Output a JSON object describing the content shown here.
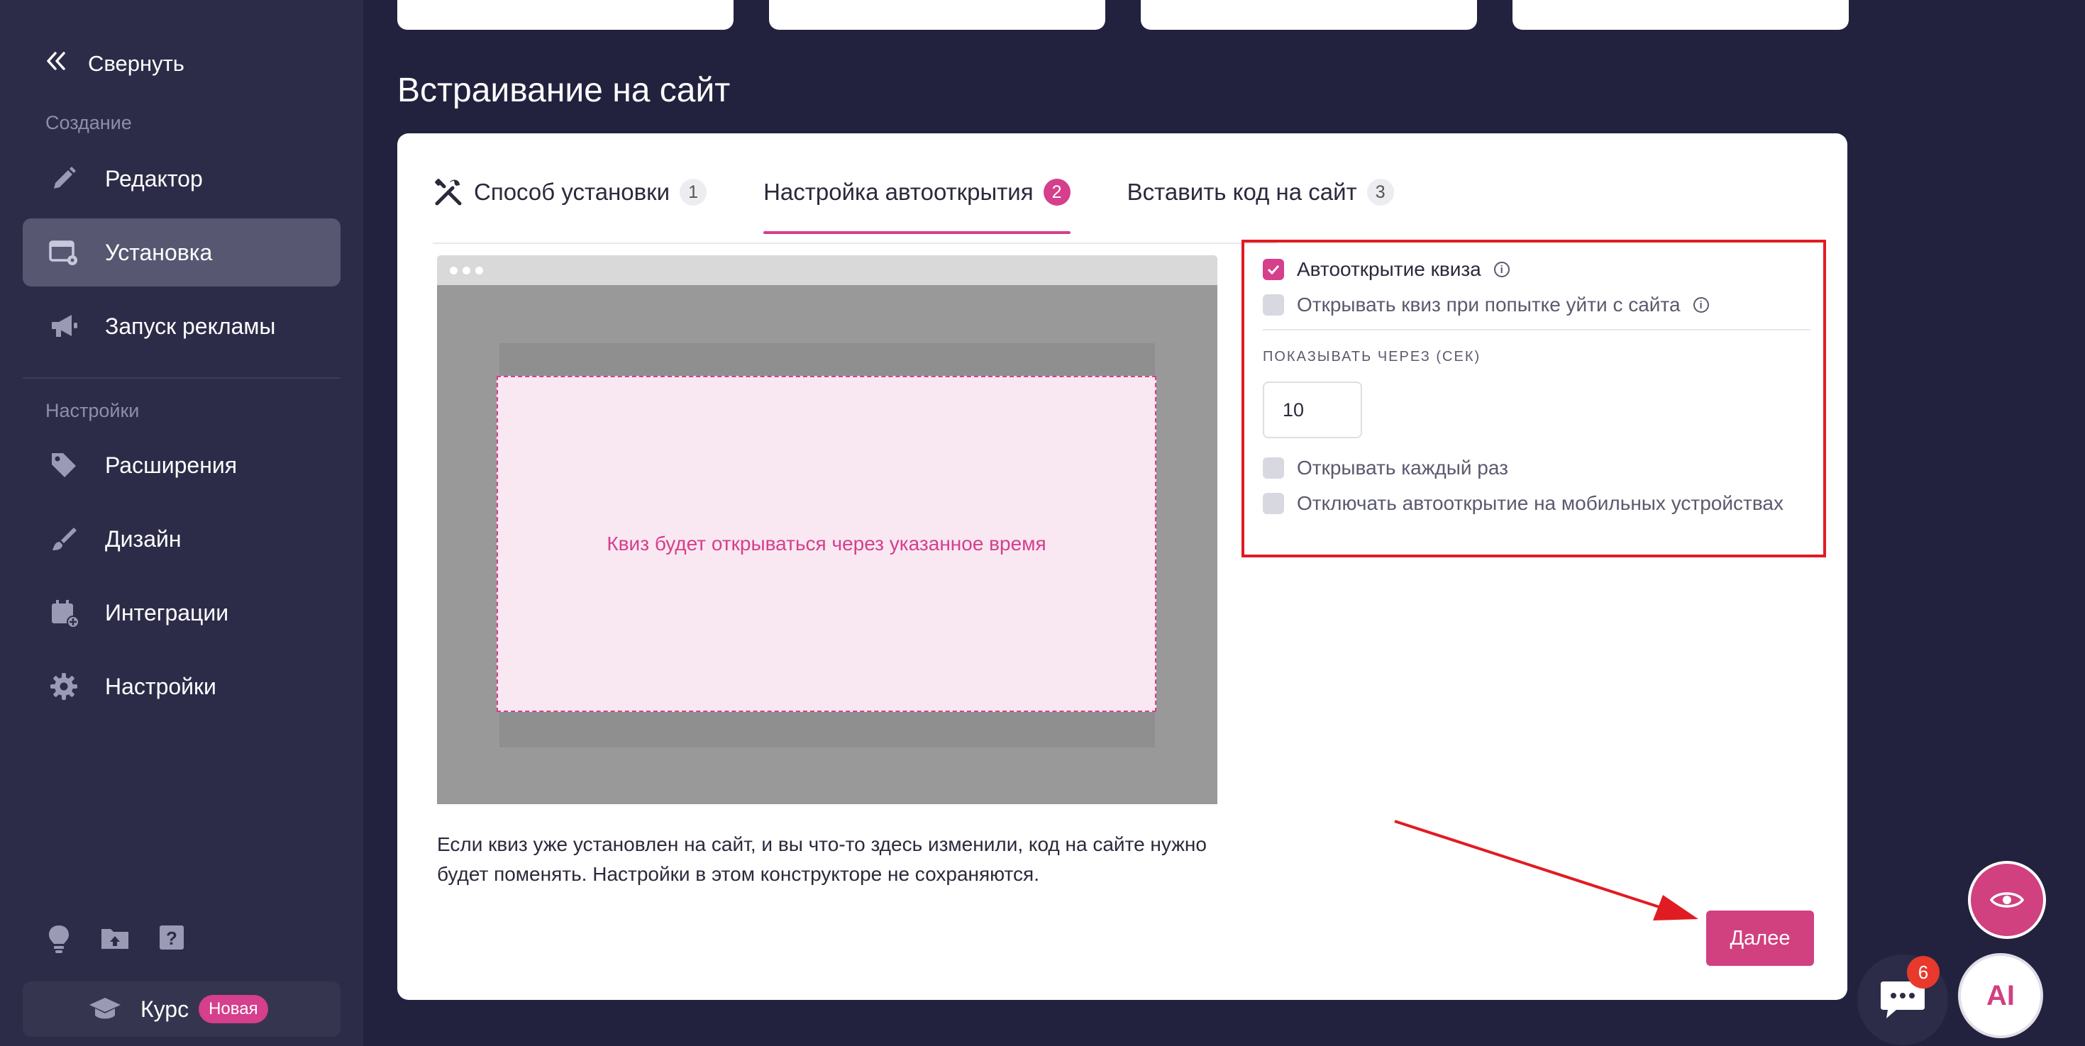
{
  "sidebar": {
    "collapse_label": "Свернуть",
    "sections": {
      "create": "Создание",
      "settings": "Настройки"
    },
    "items": [
      {
        "label": "Редактор",
        "icon": "pencil-icon"
      },
      {
        "label": "Установка",
        "icon": "install-icon",
        "active": true
      },
      {
        "label": "Запуск рекламы",
        "icon": "megaphone-icon"
      },
      {
        "label": "Расширения",
        "icon": "puzzle-tag-icon"
      },
      {
        "label": "Дизайн",
        "icon": "brush-icon"
      },
      {
        "label": "Интеграции",
        "icon": "calendar-plus-icon"
      },
      {
        "label": "Настройки",
        "icon": "gear-icon"
      }
    ],
    "bottom_icons": [
      "lightbulb-icon",
      "folder-upload-icon",
      "help-icon"
    ],
    "course": {
      "label": "Курс",
      "badge": "Новая",
      "icon": "graduation-cap-icon"
    }
  },
  "page": {
    "title": "Встраивание на сайт"
  },
  "tabs": [
    {
      "label": "Способ установки",
      "num": "1"
    },
    {
      "label": "Настройка автооткрытия",
      "num": "2",
      "active": true
    },
    {
      "label": "Вставить код на сайт",
      "num": "3"
    }
  ],
  "preview": {
    "overlay_text": "Квиз будет открываться через указанное время"
  },
  "note": "Если квиз уже установлен на сайт, и вы что-то здесь изменили, код на сайте нужно будет поменять. Настройки в этом конструкторе не сохраняются.",
  "settings": {
    "autoopen": {
      "label": "Автооткрытие квиза",
      "checked": true
    },
    "exit_intent": {
      "label": "Открывать квиз при попытке уйти с сайта",
      "checked": false
    },
    "delay_label": "ПОКАЗЫВАТЬ ЧЕРЕЗ (СЕК)",
    "delay_value": "10",
    "every_time": {
      "label": "Открывать каждый раз",
      "checked": false
    },
    "disable_mobile": {
      "label": "Отключать автооткрытие на мобильных устройствах",
      "checked": false
    }
  },
  "next_button": "Далее",
  "chat": {
    "badge": "6"
  },
  "ai_label": "AI",
  "colors": {
    "accent": "#d1407f",
    "sidebar_bg": "#2c2c48",
    "highlight": "#e11b22"
  }
}
